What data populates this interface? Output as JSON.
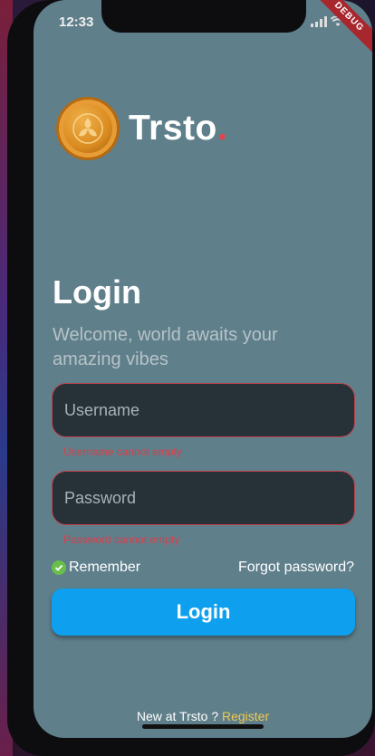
{
  "status": {
    "time": "12:33"
  },
  "debug_label": "DEBUG",
  "brand": {
    "name": "Trsto",
    "dot": "."
  },
  "login": {
    "title": "Login",
    "subtitle": "Welcome, world awaits your amazing vibes",
    "username_placeholder": "Username",
    "username_error": "Username cannot empty",
    "password_placeholder": "Password",
    "password_error": "Password cannot empty",
    "remember_label": "Remember",
    "forgot_label": "Forgot password?",
    "button_label": "Login"
  },
  "footer": {
    "question": "New at Trsto ?",
    "register_label": "Register"
  },
  "colors": {
    "accent": "#0ea0ef",
    "error": "#d8404a",
    "background": "#5f7f8b",
    "field": "#263238",
    "register": "#f2c94c"
  },
  "icons": {
    "remember": "check-circle-icon",
    "logo": "coin-logo-icon"
  }
}
